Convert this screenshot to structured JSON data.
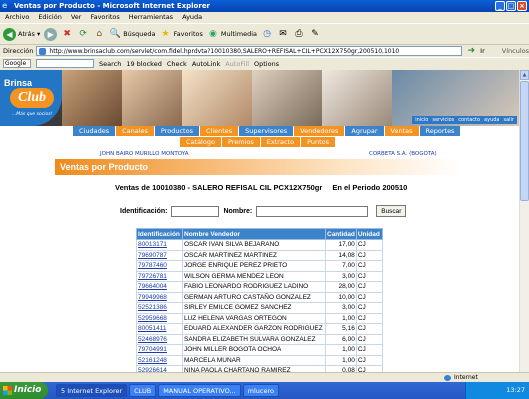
{
  "window": {
    "title": "Ventas por Producto - Microsoft Internet Explorer"
  },
  "menu": [
    "Archivo",
    "Edición",
    "Ver",
    "Favoritos",
    "Herramientas",
    "Ayuda"
  ],
  "toolbar": {
    "back": "Atrás",
    "search": "Búsqueda",
    "favorites": "Favoritos",
    "multimedia": "Multimedia"
  },
  "address": {
    "label": "Dirección",
    "url": "http://www.brinsaclub.com/servlet/com.fidel.hprdvta?10010380,SALERO+REFISAL+CIL+PCX12X750gr,200510,1010",
    "go": "Ir",
    "links": "Vínculos"
  },
  "googlebar": {
    "brand": "Google",
    "search": "Search",
    "blocked": "19 blocked",
    "check": "Check",
    "autolink": "AutoLink",
    "autofill": "AutoFill",
    "options": "Options"
  },
  "site": {
    "logo": {
      "brand": "Brinsa",
      "club": "Club",
      "tagline": "...Más que socios!"
    },
    "mininav": [
      "inicio",
      "servicios",
      "contacto",
      "ayuda",
      "salir"
    ],
    "nav_primary": [
      "Ciudades",
      "Canales",
      "Productos",
      "Clientes",
      "Supervisores",
      "Vendedores",
      "Agrupar",
      "Ventas",
      "Reportes"
    ],
    "nav_secondary": [
      "Catálogo",
      "Premios",
      "Extracto",
      "Puntos"
    ],
    "user_name": "JOHN BAIRO MURILLO MONTOYA",
    "company": "CORBETA S.A. (BOGOTA)",
    "page_title": "Ventas por Producto",
    "summary_left": "Ventas de 10010380  -  SALERO REFISAL CIL PCX12X750gr",
    "summary_right": "En el Periodo 200510",
    "form": {
      "id_label": "Identificación:",
      "name_label": "Nombre:",
      "button": "Buscar"
    },
    "table": {
      "headers": [
        "Identificación",
        "Nombre Vendedor",
        "Cantidad",
        "Unidad"
      ],
      "rows": [
        [
          "80013171",
          "OSCAR IVAN SILVA BEJARANO",
          "17,00",
          "CJ"
        ],
        [
          "79690787",
          "OSCAR MARTINEZ MARTINEZ",
          "14,08",
          "CJ"
        ],
        [
          "79787460",
          "JORGE ENRIQUE PEREZ PRIETO",
          "7,00",
          "CJ"
        ],
        [
          "79726781",
          "WILSON GERMA MENDEZ LEON",
          "3,00",
          "CJ"
        ],
        [
          "79664004",
          "FABIO LEONARDO RODRIGUEZ LADINO",
          "28,00",
          "CJ"
        ],
        [
          "79949968",
          "GERMAN ARTURO CASTAÑO GONZALEZ",
          "10,00",
          "CJ"
        ],
        [
          "52521386",
          "SIRLEY EMILCE GOMEZ SANCHEZ",
          "3,00",
          "CJ"
        ],
        [
          "52959668",
          "LUZ HELENA VARGAS ORTEGON",
          "1,00",
          "CJ"
        ],
        [
          "80051411",
          "EDUARD ALEXANDER GARZON RODRIGUEZ",
          "5,16",
          "CJ"
        ],
        [
          "52468976",
          "SANDRA ELIZABETH SULVARA GONZALEZ",
          "6,00",
          "CJ"
        ],
        [
          "79704991",
          "JOHN MILLER BOGOTA OCHOA",
          "1,00",
          "CJ"
        ],
        [
          "52161248",
          "MARCELA MUNAR",
          "1,00",
          "CJ"
        ],
        [
          "52926614",
          "NINA PAOLA CHARTANO RAMIREZ",
          "0,08",
          "CJ"
        ]
      ]
    }
  },
  "status": {
    "zone": "Internet"
  },
  "taskbar": {
    "start": "Inicio",
    "tasks": [
      "5 Internet Explorer",
      "CLUB",
      "MANUAL OPERATIVO...",
      "mlucero"
    ],
    "clock": "13:27"
  }
}
